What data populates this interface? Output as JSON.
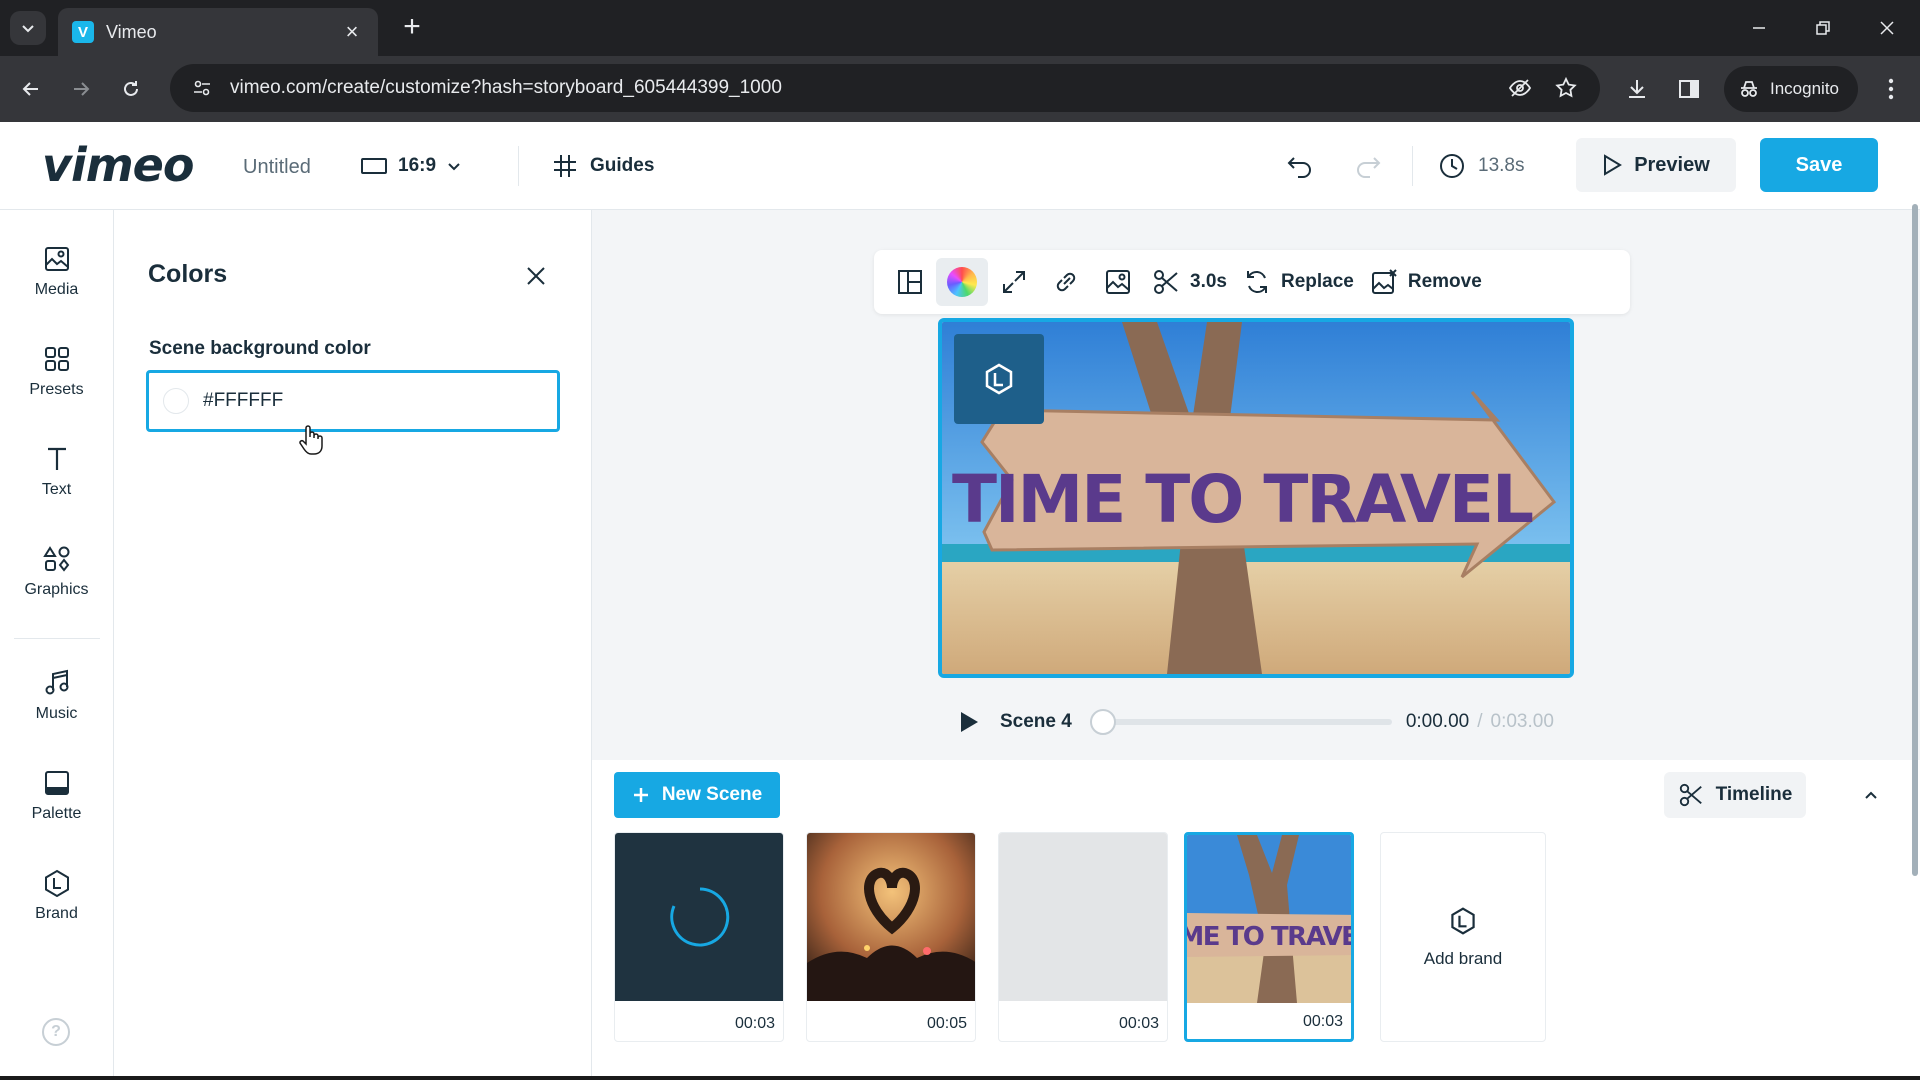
{
  "browser": {
    "tab_title": "Vimeo",
    "favicon_letter": "V",
    "url": "vimeo.com/create/customize?hash=storyboard_605444399_1000",
    "incognito_label": "Incognito"
  },
  "header": {
    "logo": "vimeo",
    "doc_title": "Untitled",
    "aspect_ratio": "16:9",
    "guides_label": "Guides",
    "duration": "13.8s",
    "preview_label": "Preview",
    "save_label": "Save"
  },
  "rail": {
    "items": [
      {
        "label": "Media",
        "icon": "image-icon"
      },
      {
        "label": "Presets",
        "icon": "grid-icon"
      },
      {
        "label": "Text",
        "icon": "text-icon"
      },
      {
        "label": "Graphics",
        "icon": "shapes-icon"
      },
      {
        "label": "Music",
        "icon": "music-icon"
      },
      {
        "label": "Palette",
        "icon": "palette-icon"
      },
      {
        "label": "Brand",
        "icon": "brand-icon"
      }
    ],
    "help": "?"
  },
  "panel": {
    "title": "Colors",
    "field_label": "Scene background color",
    "color_value": "#FFFFFF",
    "swatch_color": "#FFFFFF"
  },
  "canvas": {
    "toolbar": {
      "trim_label": "3.0s",
      "replace_label": "Replace",
      "remove_label": "Remove"
    },
    "sign_text": "TIME TO TRAVEL",
    "player": {
      "scene_name": "Scene 4",
      "current_time": "0:00.00",
      "separator": "/",
      "total_time": "0:03.00",
      "progress": 0
    }
  },
  "storyboard": {
    "new_scene_label": "New Scene",
    "timeline_label": "Timeline",
    "scenes": [
      {
        "duration": "00:03"
      },
      {
        "duration": "00:05"
      },
      {
        "duration": "00:03"
      },
      {
        "duration": "00:03",
        "thumb_text": "ME TO TRAVEI"
      }
    ],
    "add_brand_label": "Add brand"
  },
  "colors": {
    "accent": "#17a8e3",
    "text": "#1a2e3b"
  }
}
